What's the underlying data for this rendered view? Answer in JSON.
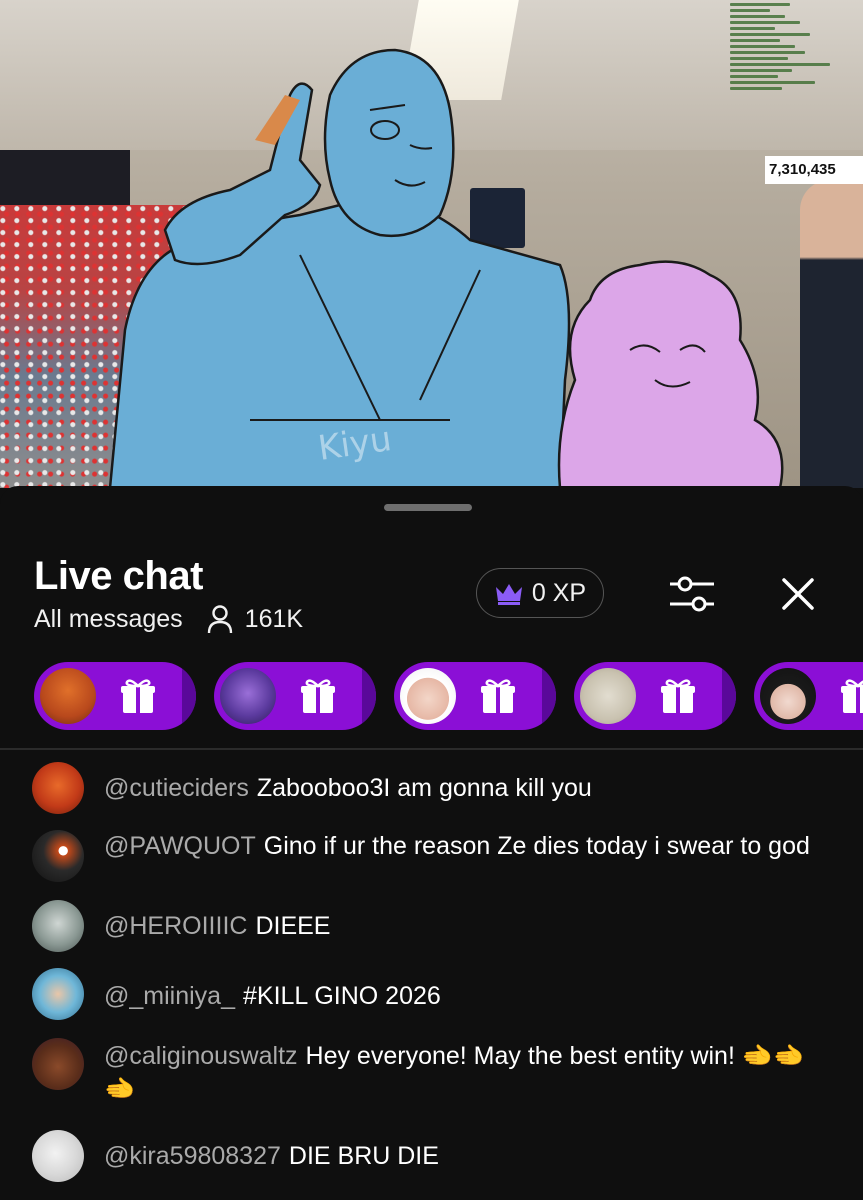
{
  "video": {
    "overlay_count": "7,310,435",
    "watermark": "Kiyu"
  },
  "chat": {
    "title": "Live chat",
    "filter_label": "All messages",
    "viewer_count": "161K",
    "xp_label": "0 XP",
    "icons": {
      "viewers": "person-icon",
      "xp": "crown-icon",
      "filter": "sliders-icon",
      "close": "close-icon",
      "gift": "gift-icon"
    },
    "colors": {
      "gift_pill": "#8b0fd6",
      "author": "#aaaaaa",
      "background": "#0f0f0f"
    },
    "gift_pills": [
      {
        "avatar": "avatar-orange-character"
      },
      {
        "avatar": "avatar-purple-character"
      },
      {
        "avatar": "avatar-white-hair-character"
      },
      {
        "avatar": "avatar-sketch-character"
      },
      {
        "avatar": "avatar-dark-hair-character"
      }
    ],
    "messages": [
      {
        "author": "@cutieciders",
        "text": "Zabooboo3I am gonna kill you"
      },
      {
        "author": "@PAWQUOT",
        "text": "Gino if ur the reason Ze dies today i swear to god"
      },
      {
        "author": "@HEROIIIIC",
        "text": "DIEEE"
      },
      {
        "author": "@_miiniya_",
        "text": "#KILL GINO   2026"
      },
      {
        "author": "@caliginouswaltz",
        "text": "Hey everyone! May the best entity win! 🫲🫲🫲"
      },
      {
        "author": "@kira59808327",
        "text": "DIE BRU DIE"
      }
    ]
  }
}
